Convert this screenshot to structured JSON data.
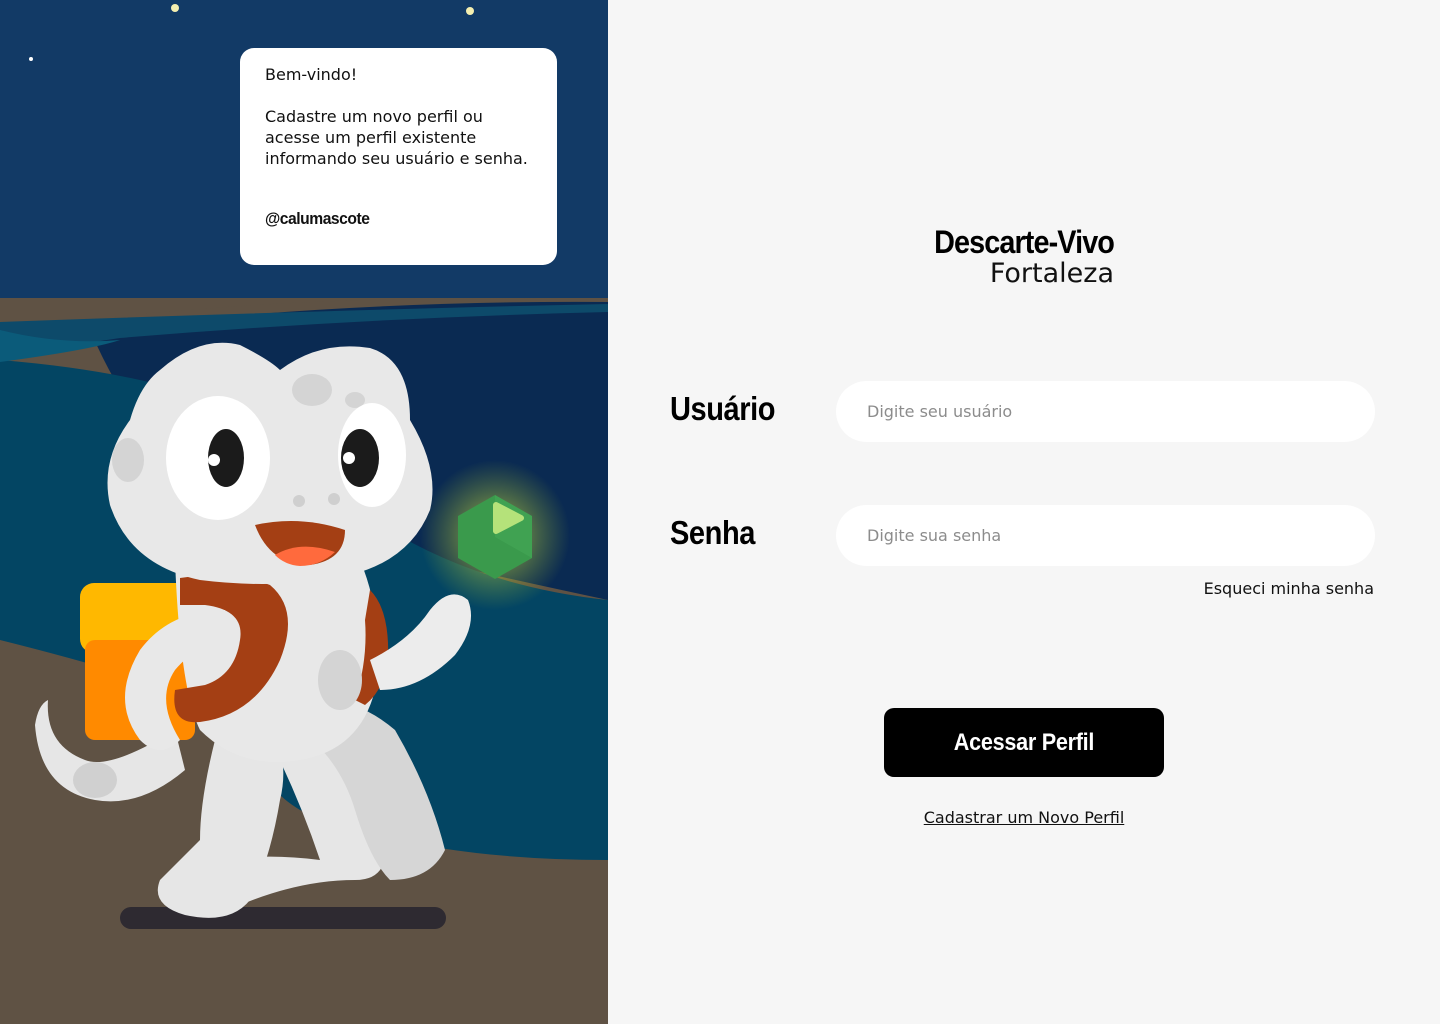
{
  "welcome": {
    "greeting": "Bem-vindo!",
    "message": "Cadastre um novo perfil ou acesse um perfil existente informando seu usuário e senha.",
    "handle": "@calumascote"
  },
  "brand": {
    "name": "Descarte-Vivo",
    "city": "Fortaleza"
  },
  "form": {
    "username_label": "Usuário",
    "username_placeholder": "Digite seu usuário",
    "username_value": "",
    "password_label": "Senha",
    "password_placeholder": "Digite sua senha",
    "password_value": "",
    "forgot_password": "Esqueci minha senha",
    "submit_label": "Acessar Perfil",
    "register_link": "Cadastrar um Novo Perfil"
  },
  "colors": {
    "sky": "#123a66",
    "ground": "#5f5244",
    "form_background": "#f6f6f6",
    "button": "#000000",
    "mascot_body": "#e8e8e8",
    "backpack": "#ffb800",
    "recycle_gem": "#3a9a4c"
  },
  "icons": {
    "mascot": "gecko-mascot-illustration",
    "gem": "recycling-hexagon-icon"
  }
}
